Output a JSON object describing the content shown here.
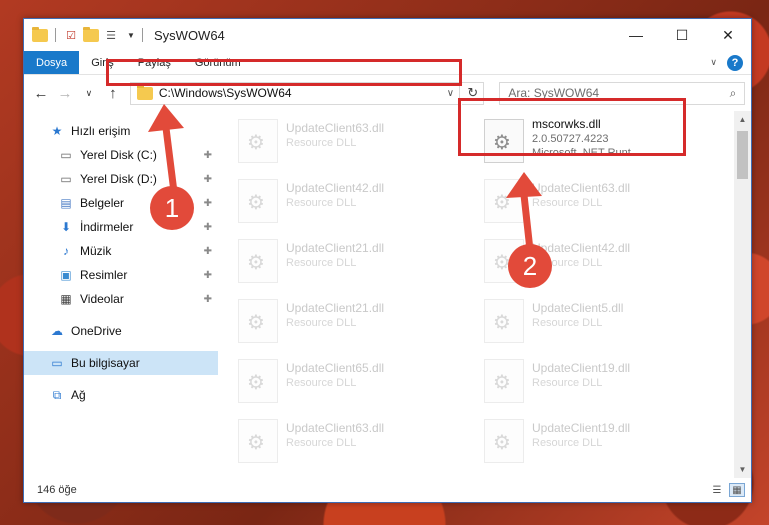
{
  "window": {
    "title": "SysWOW64",
    "controls": [
      "—",
      "☐",
      "✕"
    ]
  },
  "ribbon": {
    "tabs": [
      "Dosya",
      "Giriş",
      "Paylaş",
      "Görünüm"
    ]
  },
  "nav": {
    "address": "C:\\Windows\\SysWOW64",
    "search_placeholder": "Ara: SysWOW64"
  },
  "sidebar": {
    "items": [
      {
        "label": "Hızlı erişim",
        "icon": "star-icon"
      },
      {
        "label": "Yerel Disk (C:)",
        "icon": "drive-icon"
      },
      {
        "label": "Yerel Disk (D:)",
        "icon": "drive-icon"
      },
      {
        "label": "Belgeler",
        "icon": "documents-icon"
      },
      {
        "label": "İndirmeler",
        "icon": "download-icon"
      },
      {
        "label": "Müzik",
        "icon": "music-icon"
      },
      {
        "label": "Resimler",
        "icon": "pictures-icon"
      },
      {
        "label": "Videolar",
        "icon": "videos-icon"
      },
      {
        "label": "OneDrive",
        "icon": "cloud-icon"
      },
      {
        "label": "Bu bilgisayar",
        "icon": "computer-icon"
      },
      {
        "label": "Ağ",
        "icon": "network-icon"
      }
    ]
  },
  "files": {
    "highlighted": {
      "name": "mscorwks.dll",
      "version": "2.0.50727.4223",
      "description": "Microsoft .NET Runt..."
    },
    "left_column": [
      {
        "name": "UpdateClient63.dll",
        "sub": "Resource DLL"
      },
      {
        "name": "UpdateClient42.dll",
        "sub": "Resource DLL"
      },
      {
        "name": "UpdateClient21.dll",
        "sub": "Resource DLL"
      },
      {
        "name": "UpdateClient21.dll",
        "sub": "Resource DLL"
      },
      {
        "name": "UpdateClient65.dll",
        "sub": "Resource DLL"
      },
      {
        "name": "UpdateClient63.dll",
        "sub": "Resource DLL"
      }
    ],
    "right_column": [
      {
        "name": "UpdateClient63.dll",
        "sub": "Resource DLL"
      },
      {
        "name": "UpdateClient42.dll",
        "sub": "Resource DLL"
      },
      {
        "name": "UpdateClient5.dll",
        "sub": "Resource DLL"
      },
      {
        "name": "UpdateClient19.dll",
        "sub": "Resource DLL"
      },
      {
        "name": "UpdateClient19.dll",
        "sub": "Resource DLL"
      }
    ]
  },
  "status": {
    "count": "146 öğe"
  },
  "annotations": {
    "step1": "1",
    "step2": "2",
    "color": "#d52a2a"
  }
}
